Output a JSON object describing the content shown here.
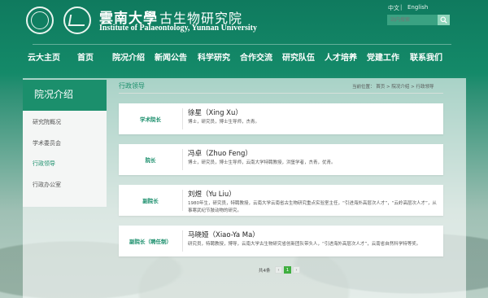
{
  "header": {
    "university_name": "雲南大學",
    "institute_name": "古生物研究院",
    "institute_en": "Institute of Palaeontology, Yunnan University",
    "lang_zh": "中文",
    "lang_sep": "|",
    "lang_en": "English",
    "search_placeholder": "站内搜索"
  },
  "nav": [
    "云大主页",
    "首页",
    "院况介绍",
    "新闻公告",
    "科学研究",
    "合作交流",
    "研究队伍",
    "人才培养",
    "党建工作",
    "联系我们"
  ],
  "sidebar": {
    "title": "院况介绍",
    "items": [
      {
        "label": "研究院概况",
        "active": false
      },
      {
        "label": "学术委员会",
        "active": false
      },
      {
        "label": "行政领导",
        "active": true
      },
      {
        "label": "行政办公室",
        "active": false
      }
    ]
  },
  "main": {
    "title": "行政领导",
    "breadcrumb": "当前位置：  首页  >  院况介绍  >  行政领导"
  },
  "leaders": [
    {
      "role": "学术院长",
      "name": "徐星（Xing Xu）",
      "desc": "博士，研究员，博士生导师，杰青。"
    },
    {
      "role": "院长",
      "name": "冯卓（Zhuo Feng）",
      "desc": "博士，研究员，博士生导师，云南大学特聘教授，洪堡学者，杰青，优青。"
    },
    {
      "role": "副院长",
      "name": "刘煜（Yu Liu）",
      "desc": "1980年生，研究员，特聘教授，云南大学云南省古生物研究重点实验室主任，“引进海外高层次人才”，“云岭高层次人才”，从事寒武纪节肢动物的研究。"
    },
    {
      "role": "副院长（聘任制）",
      "name": "马晓娅（Xiao-Ya Ma）",
      "desc": "研究员，特聘教授，博导，云南大学古生物研究省创新团队带头人，“引进海外高层次人才”，云南省自然科学特等奖。"
    }
  ],
  "pager": {
    "label": "共4条",
    "prev": "‹",
    "current": "1",
    "next": "›"
  },
  "colors": {
    "brand_green": "#1b8f6c",
    "pager_current": "#3fae3f"
  }
}
